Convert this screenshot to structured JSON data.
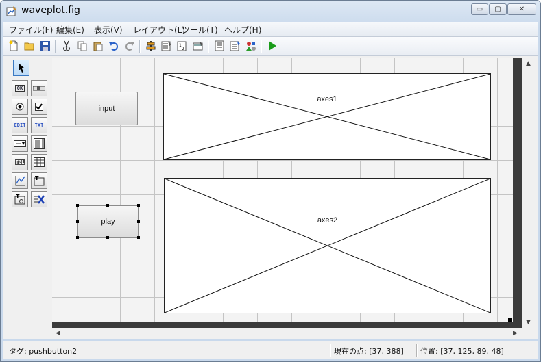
{
  "window": {
    "title": "waveplot.fig",
    "min_label": "▭",
    "max_label": "▢",
    "close_label": "✕"
  },
  "menu": [
    "ファイル(F)",
    "編集(E)",
    "表示(V)",
    "レイアウト(L)",
    "ツール(T)",
    "ヘルプ(H)"
  ],
  "toolbar_icons": [
    "new-file-icon",
    "open-folder-icon",
    "save-icon",
    "cut-icon",
    "copy-icon",
    "paste-icon",
    "undo-icon",
    "redo-icon",
    "align-icon",
    "menu-editor-icon",
    "tab-order-icon",
    "toolbar-editor-icon",
    "mfile-editor-icon",
    "property-inspector-icon",
    "object-browser-icon",
    "run-icon"
  ],
  "palette": {
    "tools": [
      {
        "name": "select-tool-icon",
        "label": ""
      },
      {
        "name": "pushbutton-tool-icon",
        "label": "OK"
      },
      {
        "name": "slider-tool-icon",
        "label": ""
      },
      {
        "name": "radio-button-tool-icon",
        "label": ""
      },
      {
        "name": "checkbox-tool-icon",
        "label": ""
      },
      {
        "name": "edit-text-tool-icon",
        "label": "EDIT"
      },
      {
        "name": "static-text-tool-icon",
        "label": "TXT"
      },
      {
        "name": "popup-menu-tool-icon",
        "label": ""
      },
      {
        "name": "listbox-tool-icon",
        "label": ""
      },
      {
        "name": "toggle-button-tool-icon",
        "label": "TGL"
      },
      {
        "name": "table-tool-icon",
        "label": ""
      },
      {
        "name": "axes-tool-icon",
        "label": ""
      },
      {
        "name": "panel-tool-icon",
        "label": "T"
      },
      {
        "name": "button-group-tool-icon",
        "label": "T"
      },
      {
        "name": "activex-tool-icon",
        "label": ""
      }
    ]
  },
  "canvas": {
    "buttons": {
      "input": "input",
      "play": "play"
    },
    "axes1_label": "axes1",
    "axes2_label": "axes2"
  },
  "status": {
    "tag": "タグ: pushbutton2",
    "current_point": "現在の点:  [37, 388]",
    "position": "位置: [37, 125, 89, 48]"
  },
  "colors": {
    "run_green": "#1a9c1a",
    "selection_blue": "#3a79c3",
    "frame_dark": "#3b3b3b"
  }
}
